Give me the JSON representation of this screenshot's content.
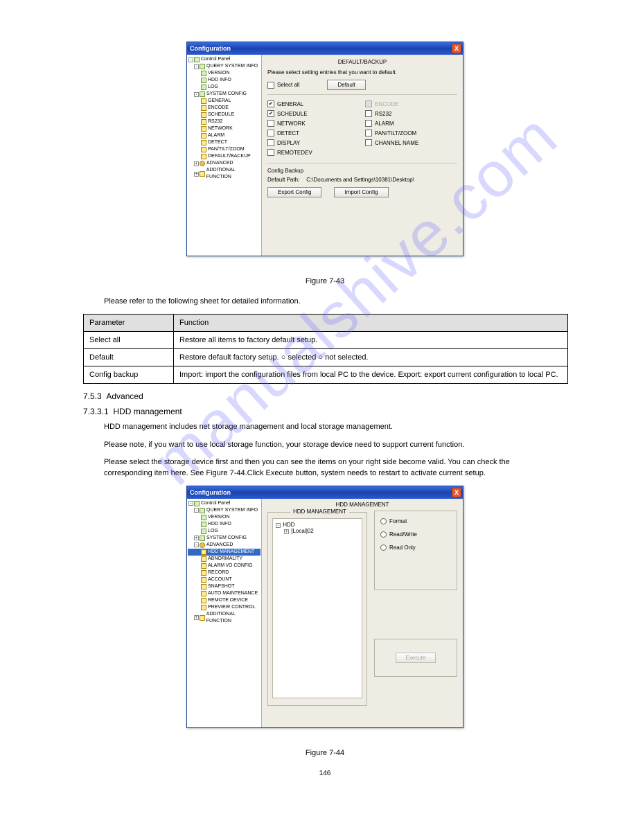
{
  "watermark": "manualshive.com",
  "win1": {
    "title": "Configuration",
    "tree": {
      "root": "Control Panel",
      "query": "QUERY SYSTEM INFO",
      "query_items": [
        "VERSION",
        "HDD INFO",
        "LOG"
      ],
      "sysconf": "SYSTEM CONFIG",
      "sysconf_items": [
        "GENERAL",
        "ENCODE",
        "SCHEDULE",
        "RS232",
        "NETWORK",
        "ALARM",
        "DETECT",
        "PAN/TILT/ZOOM",
        "DEFAULT/BACKUP"
      ],
      "advanced": "ADVANCED",
      "addfunc": "ADDITIONAL FUNCTION"
    },
    "group_title": "DEFAULT/BACKUP",
    "instruction": "Please select setting entries that you want to default.",
    "select_all": "Select all",
    "default_btn": "Default",
    "cols": {
      "left": [
        "GENERAL",
        "SCHEDULE",
        "NETWORK",
        "DETECT",
        "DISPLAY",
        "REMOTEDEV"
      ],
      "right": [
        "ENCODE",
        "RS232",
        "ALARM",
        "PAN/TILT/ZOOM",
        "CHANNEL NAME"
      ],
      "left_checked": [
        true,
        true,
        false,
        false,
        false,
        false
      ],
      "right_disabled": [
        true,
        false,
        false,
        false,
        false
      ]
    },
    "backup_label": "Config Backup",
    "path_label": "Default Path:",
    "path_value": "C:\\Documents and Settings\\10381\\Desktop\\",
    "export_btn": "Export Config",
    "import_btn": "Import Config"
  },
  "fig1_caption": "Figure 7-43",
  "intro_par": "Please refer to the following sheet for detailed information.",
  "table": {
    "h1": "Parameter",
    "h2": "Function",
    "rows": [
      [
        "Select all",
        "Restore all items to factory default setup."
      ],
      [
        "Default",
        "Restore default factory setup. ○ selected ○ not selected."
      ],
      [
        "Config backup",
        "Import: import the configuration files from local PC to the device. Export: export current configuration to local PC."
      ]
    ]
  },
  "sec2": {
    "num": "7.5.3",
    "title": "Advanced",
    "sub_num": "7.3.3.1",
    "sub_title": "HDD management",
    "par": "HDD management includes net storage management and local storage management.",
    "note": "Please note, if you want to use local storage function, your storage device need to support current function.",
    "par2": "Please select the storage device first and then you can see the items on your right side become valid. You can check the corresponding item here. See Figure 7-44.Click Execute button, system needs to restart to activate current setup."
  },
  "win2": {
    "title": "Configuration",
    "tree": {
      "root": "Control Panel",
      "query": "QUERY SYSTEM INFO",
      "query_items": [
        "VERSION",
        "HDD INFO",
        "LOG"
      ],
      "sysconf": "SYSTEM CONFIG",
      "advanced": "ADVANCED",
      "adv_items": [
        "HDD MANAGEMENT",
        "ABNORMALITY",
        "ALARM I/O CONFIG",
        "RECORD",
        "ACCOUNT",
        "SNAPSHOT",
        "AUTO MAINTENANCE",
        "REMOTE DEVICE",
        "PREVIEW CONTROL"
      ],
      "addfunc": "ADDITIONAL FUNCTION"
    },
    "group_title": "HDD MANAGEMENT",
    "inner_legend": "HDD MANAGEMENT",
    "hdd_root": "HDD",
    "hdd_item": "[Local]02",
    "radios": [
      "Format",
      "Read/Write",
      "Read Only"
    ],
    "exec_btn": "Execute"
  },
  "fig2_caption": "Figure 7-44",
  "page_number": "146"
}
